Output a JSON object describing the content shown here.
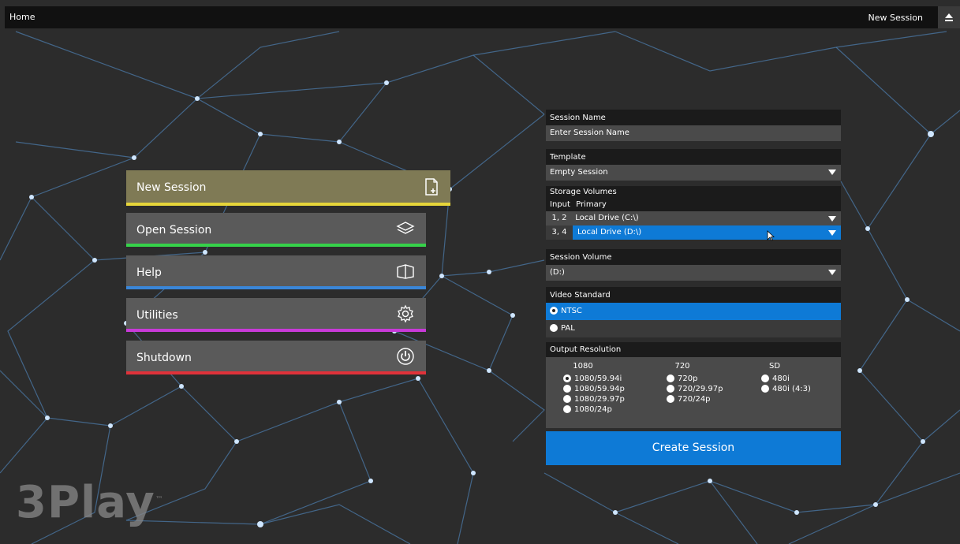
{
  "topbar": {
    "home": "Home",
    "current": "New Session"
  },
  "menu": [
    {
      "label": "New Session",
      "icon": "new-document-icon",
      "accent": "#e6d53a",
      "bg": "#7f7a55"
    },
    {
      "label": "Open Session",
      "icon": "open-layers-icon",
      "accent": "#36d24a",
      "bg": "#5a5a5a"
    },
    {
      "label": "Help",
      "icon": "book-icon",
      "accent": "#3a86d8",
      "bg": "#5a5a5a"
    },
    {
      "label": "Utilities",
      "icon": "gear-icon",
      "accent": "#c83ad8",
      "bg": "#5a5a5a"
    },
    {
      "label": "Shutdown",
      "icon": "power-icon",
      "accent": "#e0323a",
      "bg": "#5a5a5a"
    }
  ],
  "session": {
    "name_label": "Session Name",
    "name_placeholder": "Enter Session Name",
    "template_label": "Template",
    "template_value": "Empty Session",
    "storage_label": "Storage Volumes",
    "storage_cols": [
      "Input",
      "Primary"
    ],
    "storage_rows": [
      {
        "input": "1, 2",
        "drive": "Local Drive (C:\\)"
      },
      {
        "input": "3, 4",
        "drive": "Local Drive (D:\\)"
      }
    ],
    "volume_label": "Session Volume",
    "volume_value": "(D:)",
    "video_label": "Video Standard",
    "video_options": [
      "NTSC",
      "PAL"
    ],
    "video_selected": "NTSC",
    "output_label": "Output Resolution",
    "res_cols": [
      {
        "head": "1080",
        "options": [
          "1080/59.94i",
          "1080/59.94p",
          "1080/29.97p",
          "1080/24p"
        ]
      },
      {
        "head": "720",
        "options": [
          "720p",
          "720/29.97p",
          "720/24p"
        ]
      },
      {
        "head": "SD",
        "options": [
          "480i",
          "480i (4:3)"
        ]
      }
    ],
    "res_selected": "1080/59.94i",
    "create_label": "Create Session"
  },
  "logo": {
    "text": "3Play",
    "tm": "™"
  },
  "colors": {
    "accent_blue": "#0e7ad6"
  }
}
